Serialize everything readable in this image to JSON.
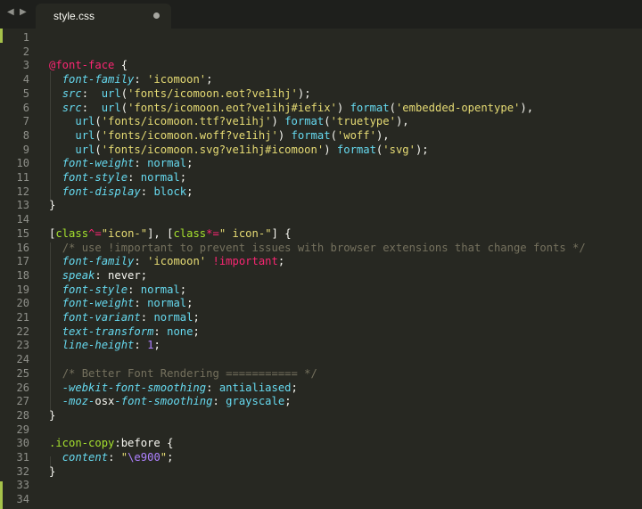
{
  "window": {
    "nav_back": "◀",
    "nav_forward": "▶"
  },
  "tab": {
    "title": "style.css",
    "modified": true
  },
  "colors": {
    "background": "#272822",
    "tabbar": "#1e1f1c",
    "gutter_mark": "#a6c24a",
    "keyword": "#f92672",
    "property": "#66d9ef",
    "string": "#e6db74",
    "function": "#a6e22e",
    "number": "#ae81ff",
    "comment": "#75715e"
  },
  "lines": [
    {
      "n": "1",
      "tokens": []
    },
    {
      "n": "2",
      "tokens": []
    },
    {
      "n": "3",
      "tokens": [
        {
          "t": "@font-face",
          "c": "pink"
        },
        {
          "t": " {",
          "c": "plain"
        }
      ]
    },
    {
      "n": "4",
      "tokens": [
        {
          "t": "  ",
          "c": "plain"
        },
        {
          "t": "font-family",
          "c": "ital"
        },
        {
          "t": ": ",
          "c": "plain"
        },
        {
          "t": "'icomoon'",
          "c": "yellow"
        },
        {
          "t": ";",
          "c": "plain"
        }
      ]
    },
    {
      "n": "5",
      "tokens": [
        {
          "t": "  ",
          "c": "plain"
        },
        {
          "t": "src",
          "c": "ital"
        },
        {
          "t": ":  ",
          "c": "plain"
        },
        {
          "t": "url",
          "c": "blue"
        },
        {
          "t": "(",
          "c": "plain"
        },
        {
          "t": "'fonts/icomoon.eot?ve1ihj'",
          "c": "yellow"
        },
        {
          "t": ");",
          "c": "plain"
        }
      ]
    },
    {
      "n": "6",
      "tokens": [
        {
          "t": "  ",
          "c": "plain"
        },
        {
          "t": "src",
          "c": "ital"
        },
        {
          "t": ":  ",
          "c": "plain"
        },
        {
          "t": "url",
          "c": "blue"
        },
        {
          "t": "(",
          "c": "plain"
        },
        {
          "t": "'fonts/icomoon.eot?ve1ihj#iefix'",
          "c": "yellow"
        },
        {
          "t": ") ",
          "c": "plain"
        },
        {
          "t": "format",
          "c": "blue"
        },
        {
          "t": "(",
          "c": "plain"
        },
        {
          "t": "'embedded-opentype'",
          "c": "yellow"
        },
        {
          "t": "),",
          "c": "plain"
        }
      ]
    },
    {
      "n": "7",
      "tokens": [
        {
          "t": "    ",
          "c": "plain"
        },
        {
          "t": "url",
          "c": "blue"
        },
        {
          "t": "(",
          "c": "plain"
        },
        {
          "t": "'fonts/icomoon.ttf?ve1ihj'",
          "c": "yellow"
        },
        {
          "t": ") ",
          "c": "plain"
        },
        {
          "t": "format",
          "c": "blue"
        },
        {
          "t": "(",
          "c": "plain"
        },
        {
          "t": "'truetype'",
          "c": "yellow"
        },
        {
          "t": "),",
          "c": "plain"
        }
      ]
    },
    {
      "n": "8",
      "tokens": [
        {
          "t": "    ",
          "c": "plain"
        },
        {
          "t": "url",
          "c": "blue"
        },
        {
          "t": "(",
          "c": "plain"
        },
        {
          "t": "'fonts/icomoon.woff?ve1ihj'",
          "c": "yellow"
        },
        {
          "t": ") ",
          "c": "plain"
        },
        {
          "t": "format",
          "c": "blue"
        },
        {
          "t": "(",
          "c": "plain"
        },
        {
          "t": "'woff'",
          "c": "yellow"
        },
        {
          "t": "),",
          "c": "plain"
        }
      ]
    },
    {
      "n": "9",
      "tokens": [
        {
          "t": "    ",
          "c": "plain"
        },
        {
          "t": "url",
          "c": "blue"
        },
        {
          "t": "(",
          "c": "plain"
        },
        {
          "t": "'fonts/icomoon.svg?ve1ihj#icomoon'",
          "c": "yellow"
        },
        {
          "t": ") ",
          "c": "plain"
        },
        {
          "t": "format",
          "c": "blue"
        },
        {
          "t": "(",
          "c": "plain"
        },
        {
          "t": "'svg'",
          "c": "yellow"
        },
        {
          "t": ");",
          "c": "plain"
        }
      ]
    },
    {
      "n": "10",
      "tokens": [
        {
          "t": "  ",
          "c": "plain"
        },
        {
          "t": "font-weight",
          "c": "ital"
        },
        {
          "t": ": ",
          "c": "plain"
        },
        {
          "t": "normal",
          "c": "blue"
        },
        {
          "t": ";",
          "c": "plain"
        }
      ]
    },
    {
      "n": "11",
      "tokens": [
        {
          "t": "  ",
          "c": "plain"
        },
        {
          "t": "font-style",
          "c": "ital"
        },
        {
          "t": ": ",
          "c": "plain"
        },
        {
          "t": "normal",
          "c": "blue"
        },
        {
          "t": ";",
          "c": "plain"
        }
      ]
    },
    {
      "n": "12",
      "tokens": [
        {
          "t": "  ",
          "c": "plain"
        },
        {
          "t": "font-display",
          "c": "ital"
        },
        {
          "t": ": ",
          "c": "plain"
        },
        {
          "t": "block",
          "c": "blue"
        },
        {
          "t": ";",
          "c": "plain"
        }
      ]
    },
    {
      "n": "13",
      "tokens": [
        {
          "t": "}",
          "c": "plain"
        }
      ]
    },
    {
      "n": "14",
      "tokens": []
    },
    {
      "n": "15",
      "tokens": [
        {
          "t": "[",
          "c": "plain"
        },
        {
          "t": "class",
          "c": "green"
        },
        {
          "t": "^=",
          "c": "pink"
        },
        {
          "t": "\"icon-\"",
          "c": "yellow"
        },
        {
          "t": "], [",
          "c": "plain"
        },
        {
          "t": "class",
          "c": "green"
        },
        {
          "t": "*=",
          "c": "pink"
        },
        {
          "t": "\" icon-\"",
          "c": "yellow"
        },
        {
          "t": "] {",
          "c": "plain"
        }
      ]
    },
    {
      "n": "16",
      "tokens": [
        {
          "t": "  ",
          "c": "plain"
        },
        {
          "t": "/* use !important to prevent issues with browser extensions that change fonts */",
          "c": "comment"
        }
      ]
    },
    {
      "n": "17",
      "tokens": [
        {
          "t": "  ",
          "c": "plain"
        },
        {
          "t": "font-family",
          "c": "ital"
        },
        {
          "t": ": ",
          "c": "plain"
        },
        {
          "t": "'icomoon'",
          "c": "yellow"
        },
        {
          "t": " ",
          "c": "plain"
        },
        {
          "t": "!important",
          "c": "pink"
        },
        {
          "t": ";",
          "c": "plain"
        }
      ]
    },
    {
      "n": "18",
      "tokens": [
        {
          "t": "  ",
          "c": "plain"
        },
        {
          "t": "speak",
          "c": "ital"
        },
        {
          "t": ": never;",
          "c": "plain"
        }
      ]
    },
    {
      "n": "19",
      "tokens": [
        {
          "t": "  ",
          "c": "plain"
        },
        {
          "t": "font-style",
          "c": "ital"
        },
        {
          "t": ": ",
          "c": "plain"
        },
        {
          "t": "normal",
          "c": "blue"
        },
        {
          "t": ";",
          "c": "plain"
        }
      ]
    },
    {
      "n": "20",
      "tokens": [
        {
          "t": "  ",
          "c": "plain"
        },
        {
          "t": "font-weight",
          "c": "ital"
        },
        {
          "t": ": ",
          "c": "plain"
        },
        {
          "t": "normal",
          "c": "blue"
        },
        {
          "t": ";",
          "c": "plain"
        }
      ]
    },
    {
      "n": "21",
      "tokens": [
        {
          "t": "  ",
          "c": "plain"
        },
        {
          "t": "font-variant",
          "c": "ital"
        },
        {
          "t": ": ",
          "c": "plain"
        },
        {
          "t": "normal",
          "c": "blue"
        },
        {
          "t": ";",
          "c": "plain"
        }
      ]
    },
    {
      "n": "22",
      "tokens": [
        {
          "t": "  ",
          "c": "plain"
        },
        {
          "t": "text-transform",
          "c": "ital"
        },
        {
          "t": ": ",
          "c": "plain"
        },
        {
          "t": "none",
          "c": "blue"
        },
        {
          "t": ";",
          "c": "plain"
        }
      ]
    },
    {
      "n": "23",
      "tokens": [
        {
          "t": "  ",
          "c": "plain"
        },
        {
          "t": "line-height",
          "c": "ital"
        },
        {
          "t": ": ",
          "c": "plain"
        },
        {
          "t": "1",
          "c": "purple"
        },
        {
          "t": ";",
          "c": "plain"
        }
      ]
    },
    {
      "n": "24",
      "tokens": []
    },
    {
      "n": "25",
      "tokens": [
        {
          "t": "  ",
          "c": "plain"
        },
        {
          "t": "/* Better Font Rendering =========== */",
          "c": "comment"
        }
      ]
    },
    {
      "n": "26",
      "tokens": [
        {
          "t": "  ",
          "c": "plain"
        },
        {
          "t": "-webkit-font-smoothing",
          "c": "ital"
        },
        {
          "t": ": ",
          "c": "plain"
        },
        {
          "t": "antialiased",
          "c": "blue"
        },
        {
          "t": ";",
          "c": "plain"
        }
      ]
    },
    {
      "n": "27",
      "tokens": [
        {
          "t": "  ",
          "c": "plain"
        },
        {
          "t": "-moz-",
          "c": "ital"
        },
        {
          "t": "osx",
          "c": "plain"
        },
        {
          "t": "-font-smoothing",
          "c": "ital"
        },
        {
          "t": ": ",
          "c": "plain"
        },
        {
          "t": "grayscale",
          "c": "blue"
        },
        {
          "t": ";",
          "c": "plain"
        }
      ]
    },
    {
      "n": "28",
      "tokens": [
        {
          "t": "}",
          "c": "plain"
        }
      ]
    },
    {
      "n": "29",
      "tokens": []
    },
    {
      "n": "30",
      "tokens": [
        {
          "t": ".icon-copy",
          "c": "green"
        },
        {
          "t": ":before",
          "c": "plain"
        },
        {
          "t": " {",
          "c": "plain"
        }
      ]
    },
    {
      "n": "31",
      "tokens": [
        {
          "t": "  ",
          "c": "plain"
        },
        {
          "t": "content",
          "c": "ital"
        },
        {
          "t": ": ",
          "c": "plain"
        },
        {
          "t": "\"",
          "c": "yellow"
        },
        {
          "t": "\\e900",
          "c": "purple"
        },
        {
          "t": "\"",
          "c": "yellow"
        },
        {
          "t": ";",
          "c": "plain"
        }
      ]
    },
    {
      "n": "32",
      "tokens": [
        {
          "t": "}",
          "c": "plain"
        }
      ]
    },
    {
      "n": "33",
      "tokens": []
    },
    {
      "n": "34",
      "tokens": []
    }
  ]
}
